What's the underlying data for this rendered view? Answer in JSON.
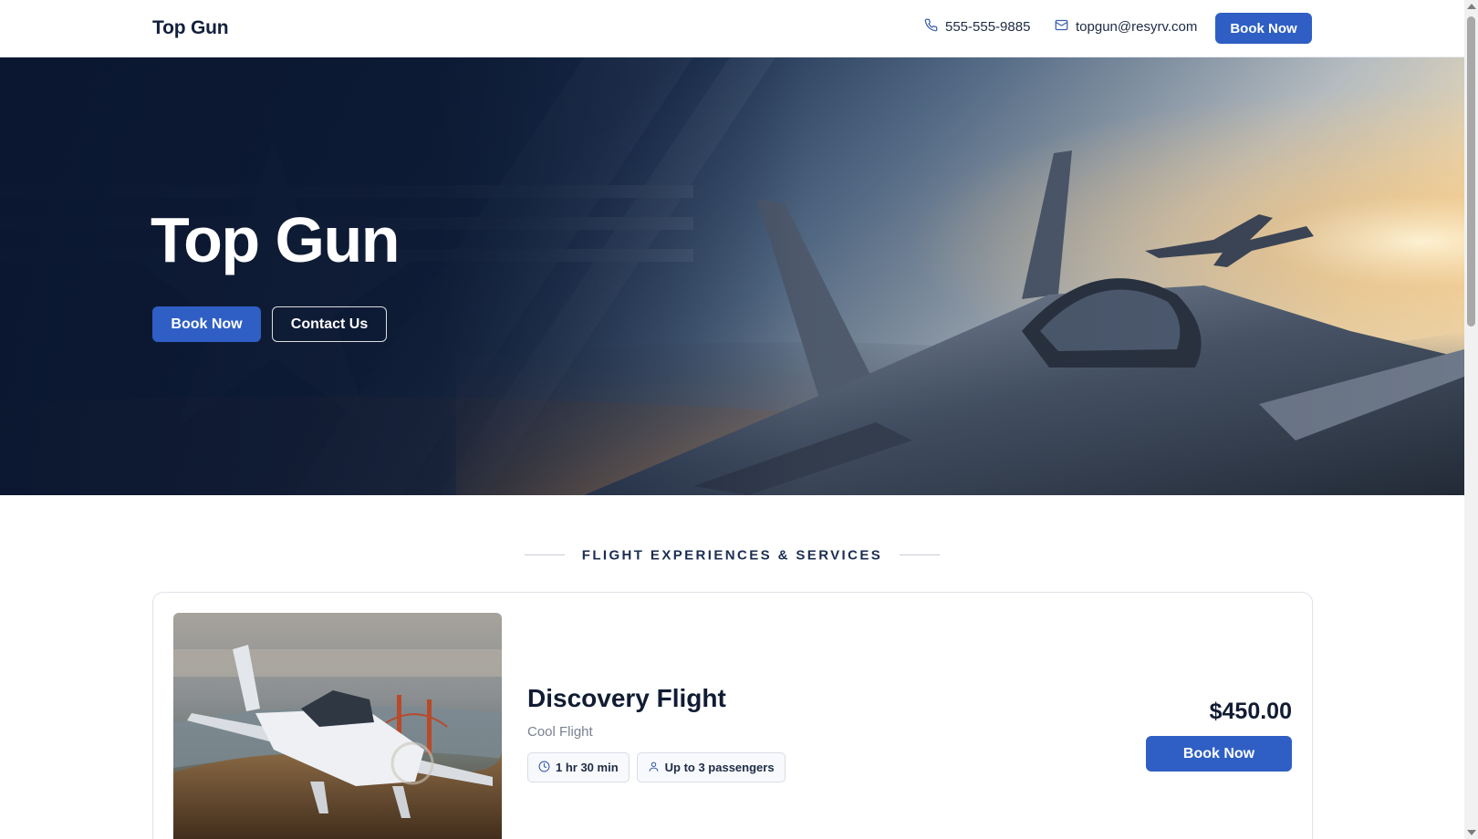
{
  "header": {
    "brand": "Top Gun",
    "phone": "555-555-9885",
    "email": "topgun@resyrv.com",
    "book_label": "Book Now"
  },
  "hero": {
    "title": "Top Gun",
    "book_label": "Book Now",
    "contact_label": "Contact Us"
  },
  "section": {
    "title": "FLIGHT EXPERIENCES & SERVICES"
  },
  "service": {
    "name": "Discovery Flight",
    "subtitle": "Cool Flight",
    "duration": "1 hr 30 min",
    "passengers": "Up to 3 passengers",
    "price": "$450.00",
    "book_label": "Book Now"
  },
  "colors": {
    "primary": "#2f5fc4",
    "navy": "#0f1b33",
    "hero_dark": "#0b1730"
  },
  "icons": [
    "phone-icon",
    "mail-icon",
    "clock-icon",
    "user-icon"
  ]
}
